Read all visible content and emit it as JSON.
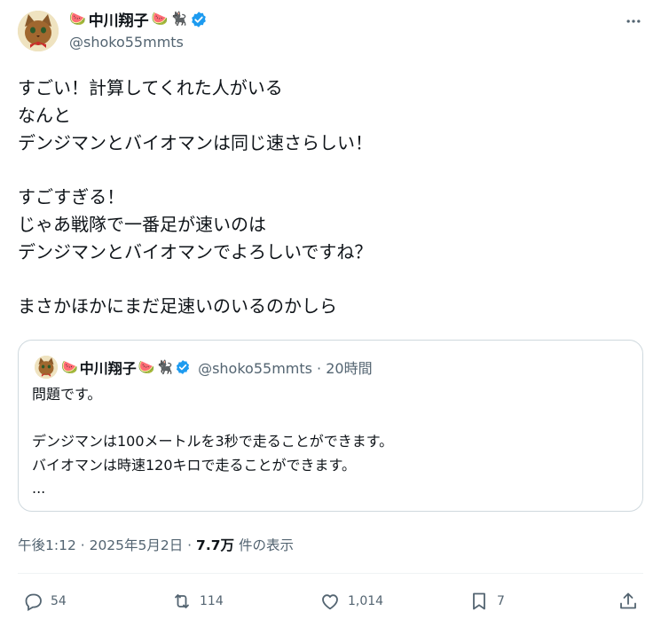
{
  "author": {
    "display_name": "中川翔子",
    "handle": "@shoko55mmts",
    "name_emojis": [
      "🍉",
      "🍉",
      "🐈‍⬛"
    ]
  },
  "post": {
    "lines": "すごい！計算してくれた人がいる\nなんと\nデンジマンとバイオマンは同じ速さらしい！\n\nすごすぎる！\nじゃあ戦隊で一番足が速いのは\nデンジマンとバイオマンでよろしいですね？\n\nまさかほかにまだ足速いのいるのかしら"
  },
  "quoted": {
    "display_name": "中川翔子",
    "handle_time": "@shoko55mmts · 20時間",
    "text": "問題です。\n\nデンジマンは100メートルを3秒で走ることができます。\nバイオマンは時速120キロで走ることができます。\n..."
  },
  "meta": {
    "time": "午後1:12 · 2025年5月2日 · ",
    "views_count": "7.7万",
    "views_label": " 件の表示"
  },
  "actions": {
    "replies": "54",
    "reposts": "114",
    "likes": "1,014",
    "bookmarks": "7"
  },
  "colors": {
    "verified": "#1d9bf0",
    "secondary_text": "#536471",
    "border": "#cfd9de"
  }
}
